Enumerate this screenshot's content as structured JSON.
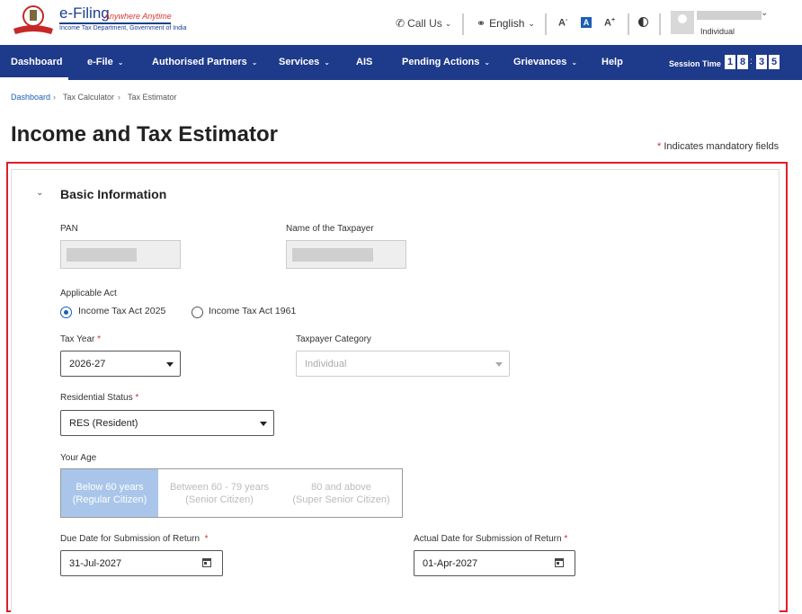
{
  "header": {
    "logo_title": "e-Filing",
    "logo_tagline": "Anywhere Anytime",
    "logo_dept": "Income Tax Department, Government of India",
    "call_us": "Call Us",
    "language": "English",
    "font_decrease": "A",
    "font_normal": "A",
    "font_increase": "A",
    "user_role": "Individual"
  },
  "nav": {
    "items": [
      {
        "label": "Dashboard",
        "dropdown": false
      },
      {
        "label": "e-File",
        "dropdown": true
      },
      {
        "label": "Authorised Partners",
        "dropdown": true
      },
      {
        "label": "Services",
        "dropdown": true
      },
      {
        "label": "AIS",
        "dropdown": false
      },
      {
        "label": "Pending Actions",
        "dropdown": true
      },
      {
        "label": "Grievances",
        "dropdown": true
      },
      {
        "label": "Help",
        "dropdown": false
      }
    ],
    "session_label": "Session Time",
    "session_digits": [
      "1",
      "8",
      "3",
      "5"
    ]
  },
  "breadcrumb": [
    "Dashboard",
    "Tax Calculator",
    "Tax Estimator"
  ],
  "page_title": "Income and Tax Estimator",
  "mandatory_note": "Indicates mandatory fields",
  "section": {
    "title": "Basic Information",
    "pan_label": "PAN",
    "name_label": "Name of the Taxpayer",
    "applicable_act_label": "Applicable Act",
    "acts": [
      "Income Tax Act 2025",
      "Income Tax Act 1961"
    ],
    "selected_act": "Income Tax Act 2025",
    "tax_year_label": "Tax Year",
    "tax_year_value": "2026-27",
    "taxpayer_category_label": "Taxpayer Category",
    "taxpayer_category_value": "Individual",
    "residential_status_label": "Residential Status",
    "residential_status_value": "RES (Resident)",
    "age_label": "Your Age",
    "age_options": [
      {
        "line1": "Below 60 years",
        "line2": "(Regular Citizen)"
      },
      {
        "line1": "Between 60 - 79 years",
        "line2": "(Senior Citizen)"
      },
      {
        "line1": "80 and above",
        "line2": "(Super Senior Citizen)"
      }
    ],
    "due_date_label": "Due Date for Submission of Return",
    "due_date_value": "31-Jul-2027",
    "actual_date_label": "Actual Date for Submission of Return",
    "actual_date_value": "01-Apr-2027"
  },
  "colors": {
    "nav_bg": "#1e3a8a",
    "accent": "#1a5fb4",
    "highlight_border": "#e11d2a",
    "age_active": "#a9c6ea"
  }
}
